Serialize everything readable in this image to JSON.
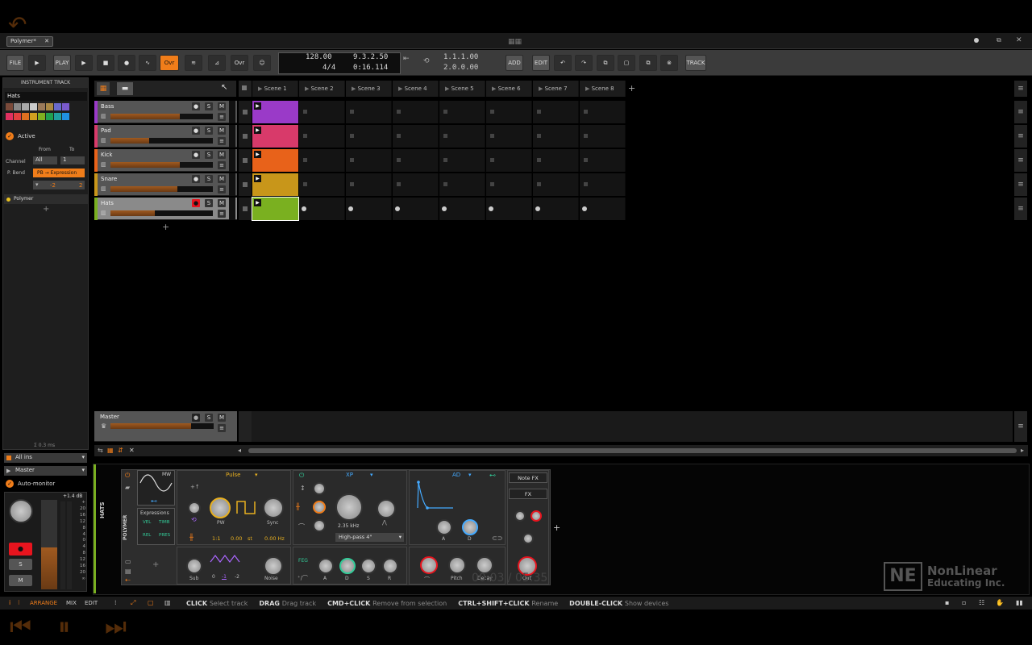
{
  "window": {
    "tab_title": "Polymer*"
  },
  "toolbar": {
    "file": "FILE",
    "play_label": "PLAY",
    "ovr1": "Ovr",
    "ovr2": "Ovr",
    "tempo": "128.00",
    "time_sig": "4/4",
    "position": "9.3.2.50",
    "time": "0:16.114",
    "loop_start": "1.1.1.00",
    "loop_len": "2.0.0.00",
    "add": "ADD",
    "edit": "EDIT",
    "track": "TRACK"
  },
  "left": {
    "header": "INSTRUMENT TRACK",
    "name": "Hats",
    "active": "Active",
    "from": "From",
    "to": "To",
    "channel_label": "Channel",
    "channel_from": "All",
    "channel_to": "1",
    "pbend_label": "P. Bend",
    "pbend_value": "PB → Expression",
    "pb_min": "-2",
    "pb_max": "2",
    "device": "Polymer",
    "latency": "Σ 0.3 ms",
    "input": "All ins",
    "output": "Master",
    "auto_monitor": "Auto-monitor",
    "gain": "+1.4 dB",
    "meter_ticks": [
      "+",
      "20",
      "16",
      "12",
      "8",
      "4",
      "0",
      "4",
      "8",
      "12",
      "16",
      "20",
      "∞"
    ],
    "s": "S",
    "m": "M",
    "swatches": [
      "#7a4a3a",
      "#888888",
      "#aaaaaa",
      "#cccccc",
      "#9a7a5a",
      "#aa8844",
      "#6a6acc",
      "#7a5acc",
      "#e03060",
      "#e04040",
      "#e07020",
      "#d0a020",
      "#80b020",
      "#20a050",
      "#20a0a0",
      "#2090e0"
    ]
  },
  "tracks": [
    {
      "name": "Bass",
      "color": "#9a3ac8",
      "fill": 0.68
    },
    {
      "name": "Pad",
      "color": "#d83a6a",
      "fill": 0.38
    },
    {
      "name": "Kick",
      "color": "#e8621a",
      "fill": 0.68
    },
    {
      "name": "Snare",
      "color": "#c8961a",
      "fill": 0.65
    },
    {
      "name": "Hats",
      "color": "#7ab020",
      "fill": 0.43
    }
  ],
  "scenes": [
    "Scene 1",
    "Scene 2",
    "Scene 3",
    "Scene 4",
    "Scene 5",
    "Scene 6",
    "Scene 7",
    "Scene 8"
  ],
  "master": {
    "name": "Master",
    "fill": 0.78
  },
  "device": {
    "track_label": "HATS",
    "device_label": "POLYMER",
    "mw": "MW",
    "osc_mode": "Pulse",
    "pw": "PW",
    "sync": "Sync",
    "ratio": "1:1",
    "semi": "0.00",
    "st": "st",
    "hz": "0.00 Hz",
    "expressions": "Expressions",
    "vel": "VEL",
    "timb": "TIMB",
    "rel": "REL",
    "pres": "PRES",
    "sub": "Sub",
    "noise": "Noise",
    "sub_vals": [
      "0",
      "-1",
      "-2"
    ],
    "filter": "XP",
    "cutoff": "2.35 kHz",
    "filter_type": "High-pass 4\"",
    "feg": "FEG",
    "a": "A",
    "d": "D",
    "s": "S",
    "r": "R",
    "env": "AD",
    "env_a": "A",
    "env_d": "D",
    "pitch": "Pitch",
    "decay": "Decay",
    "out": "Out",
    "note_fx": "Note FX",
    "fx": "FX"
  },
  "status": {
    "mode_arrange": "ARRANGE",
    "mode_mix": "MIX",
    "mode_edit": "EDIT",
    "hints": [
      {
        "key": "CLICK",
        "val": "Select track"
      },
      {
        "key": "DRAG",
        "val": "Drag track"
      },
      {
        "key": "CMD+CLICK",
        "val": "Remove from selection"
      },
      {
        "key": "CTRL+SHIFT+CLICK",
        "val": "Rename"
      },
      {
        "key": "DOUBLE-CLICK",
        "val": "Show devices"
      }
    ]
  },
  "watermark": {
    "logo": "NE",
    "line1": "NonLinear",
    "line2": "Educating Inc.",
    "timecode": "00:03 / 05:35"
  }
}
